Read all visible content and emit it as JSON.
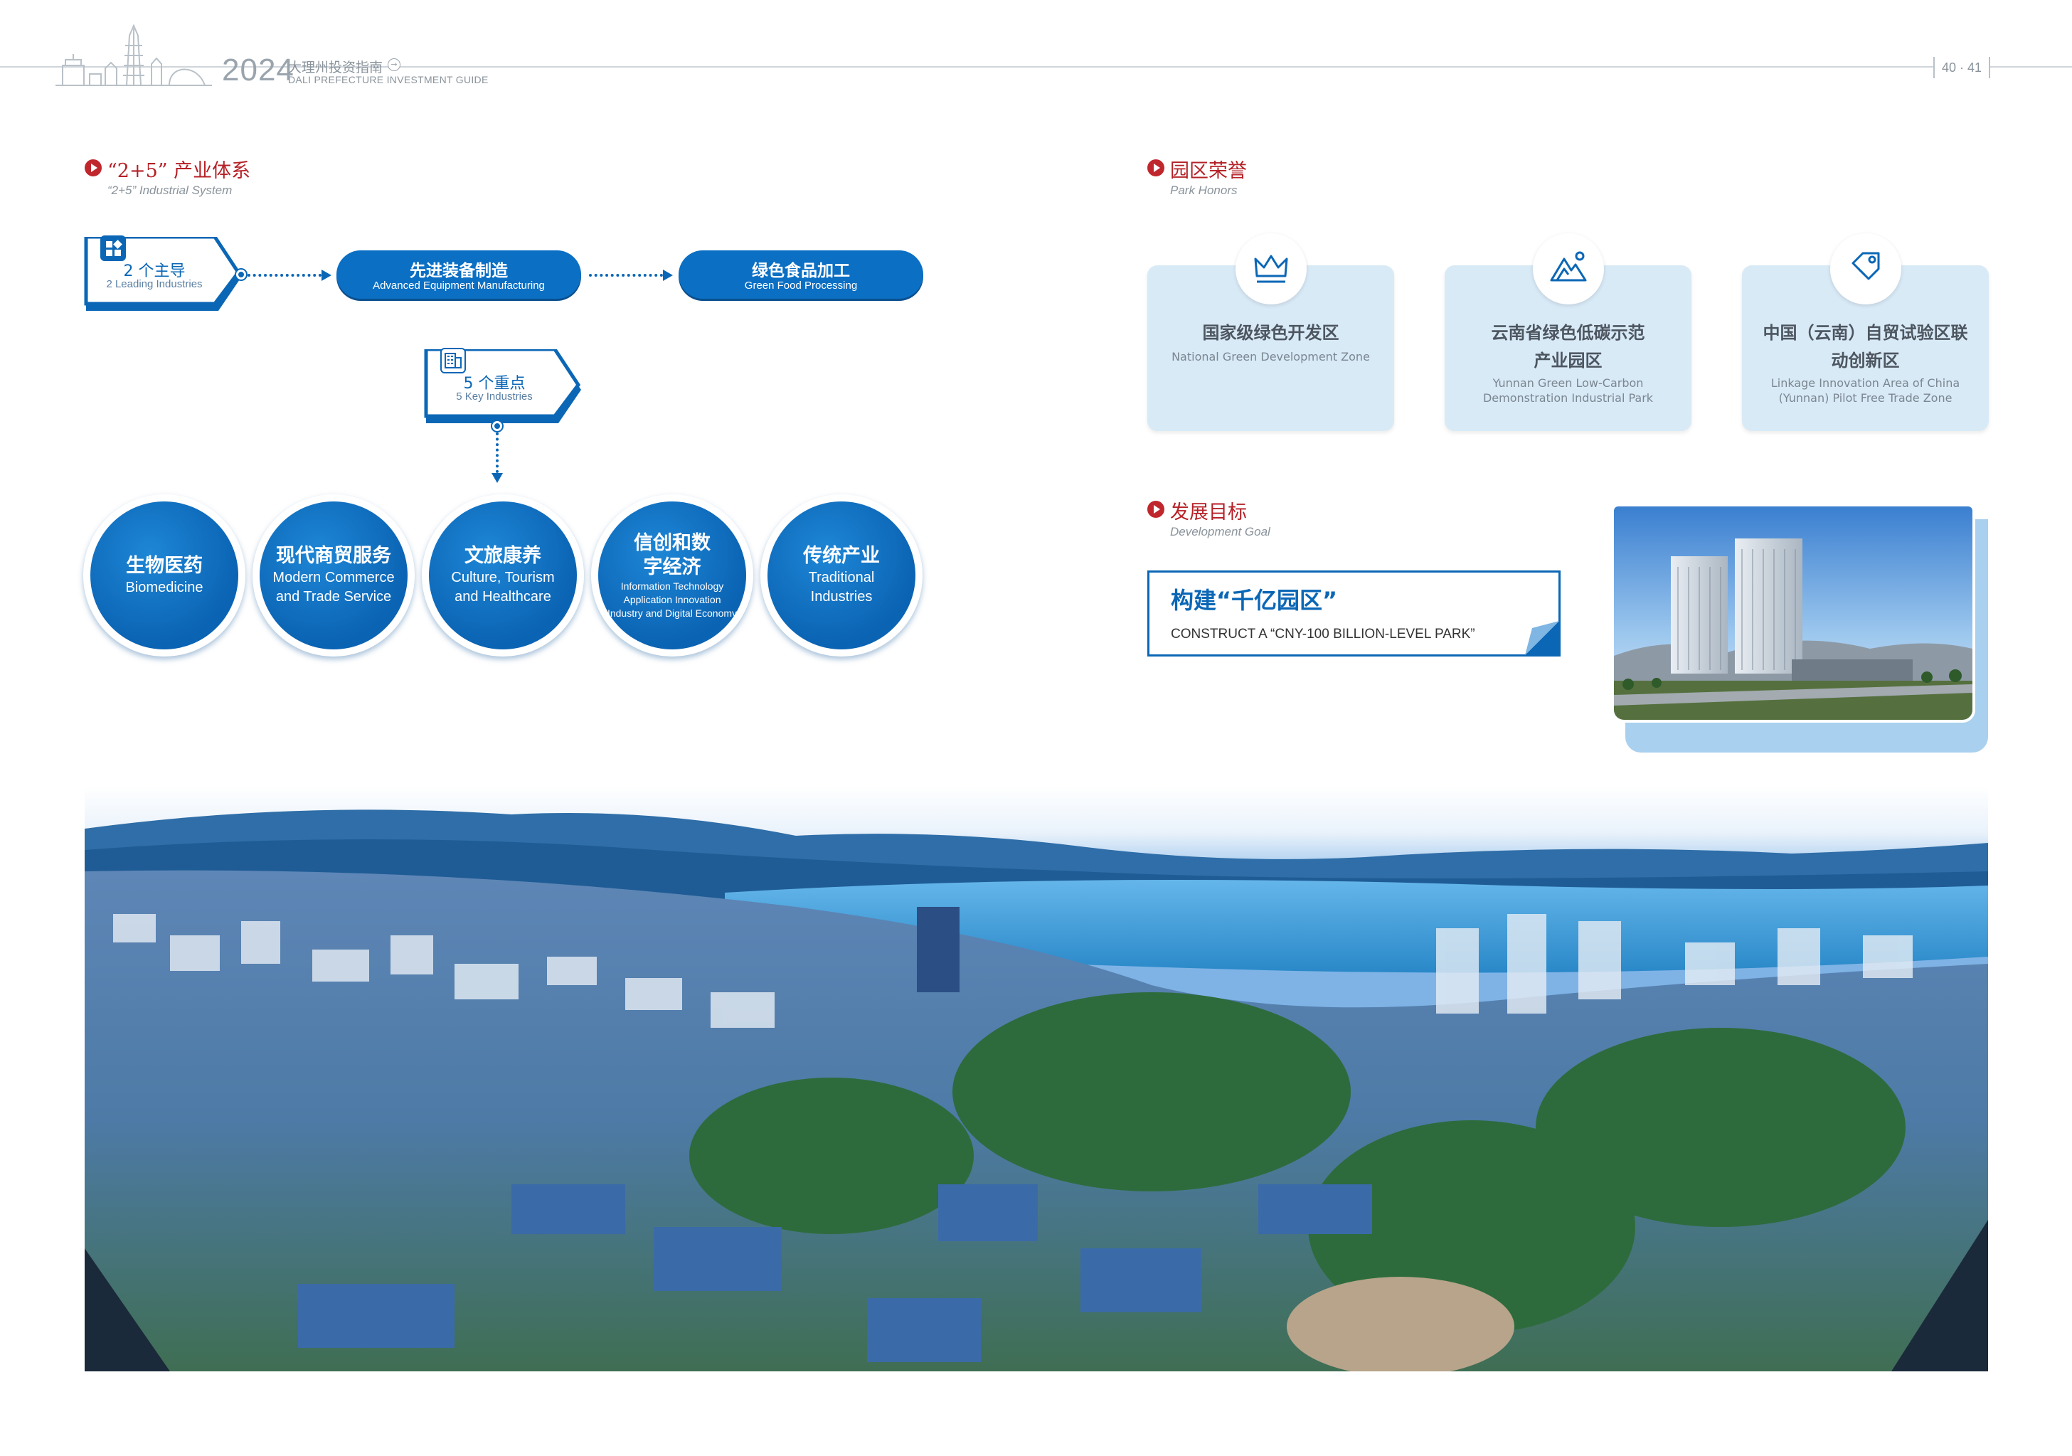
{
  "header": {
    "year": "2024",
    "title_cn": "大理州投资指南",
    "title_en": "DALI PREFECTURE INVESTMENT GUIDE",
    "arrow_glyph": "→",
    "pages": "40 · 41"
  },
  "industrial_system": {
    "heading_cn": "“2+5” 产业体系",
    "heading_en": "“2+5” Industrial System",
    "leading": {
      "label_cn": "2 个主导",
      "label_en": "2 Leading Industries",
      "items": [
        {
          "cn": "先进装备制造",
          "en": "Advanced Equipment Manufacturing"
        },
        {
          "cn": "绿色食品加工",
          "en": "Green Food Processing"
        }
      ]
    },
    "key": {
      "label_cn": "5 个重点",
      "label_en": "5 Key Industries",
      "items": [
        {
          "cn": "生物医药",
          "en": "Biomedicine"
        },
        {
          "cn": "现代商贸服务",
          "en": "Modern Commerce and Trade Service"
        },
        {
          "cn": "文旅康养",
          "en": "Culture, Tourism and Healthcare"
        },
        {
          "cn": "信创和数字经济",
          "en": "Information Technology Application Innovation Industry and Digital Economy"
        },
        {
          "cn": "传统产业",
          "en": "Traditional Industries"
        }
      ]
    }
  },
  "park_honors": {
    "heading_cn": "园区荣誉",
    "heading_en": "Park Honors",
    "items": [
      {
        "icon": "crown-icon",
        "cn": "国家级绿色开发区",
        "en": "National Green Development Zone"
      },
      {
        "icon": "mountain-icon",
        "cn": "云南省绿色低碳示范产业园区",
        "en": "Yunnan Green Low-Carbon Demonstration Industrial Park"
      },
      {
        "icon": "tag-icon",
        "cn": "中国（云南）自贸试验区联动创新区",
        "en": "Linkage Innovation Area of China (Yunnan) Pilot Free Trade Zone"
      }
    ]
  },
  "development_goal": {
    "heading_cn": "发展目标",
    "heading_en": "Development Goal",
    "goal_cn": "构建“千亿园区”",
    "goal_en": "CONSTRUCT A “CNY-100 BILLION-LEVEL PARK”"
  },
  "colors": {
    "primary_blue": "#0b67b6",
    "heading_red": "#b52127",
    "card_bg": "#d9eaf7"
  }
}
